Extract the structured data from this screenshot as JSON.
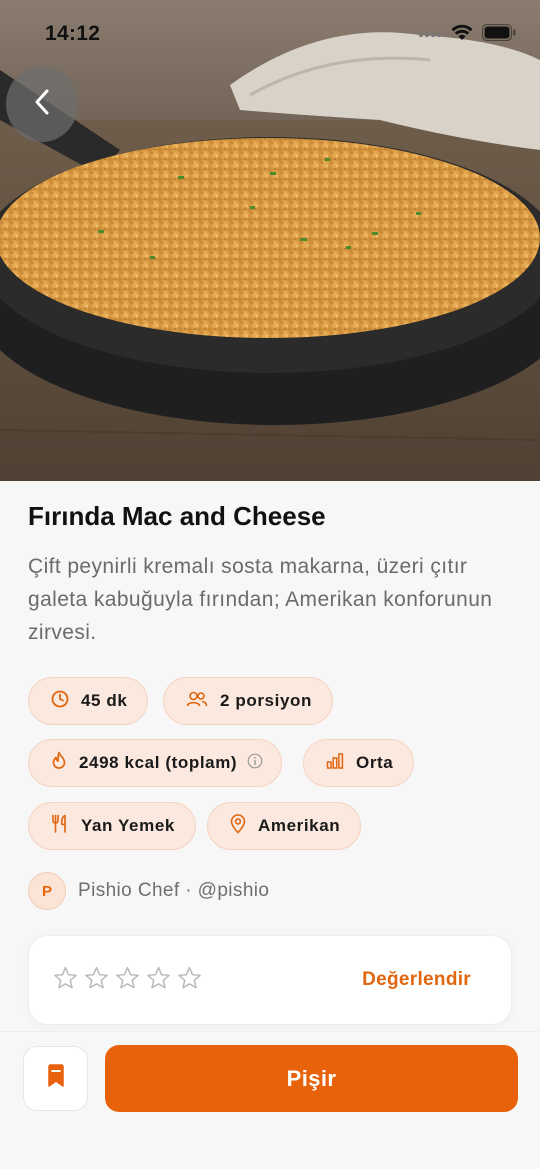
{
  "status_bar": {
    "time": "14:12"
  },
  "recipe": {
    "title": "Fırında Mac and Cheese",
    "description": "Çift peynirli kremalı sosta makarna, üzeri çıtır galeta kabuğuyla fırından; Amerikan konforunun zirvesi."
  },
  "chips": {
    "time": {
      "label": "45 dk",
      "icon": "clock-icon"
    },
    "servings": {
      "label": "2 porsiyon",
      "icon": "users-icon"
    },
    "calories": {
      "label": "2498 kcal (toplam)",
      "icon": "flame-icon",
      "info_icon": "info-icon"
    },
    "difficulty": {
      "label": "Orta",
      "icon": "bar-chart-icon"
    },
    "category": {
      "label": "Yan Yemek",
      "icon": "fork-knife-icon"
    },
    "cuisine": {
      "label": "Amerikan",
      "icon": "map-pin-icon"
    }
  },
  "author": {
    "initial": "P",
    "text": "Pishio Chef · @pishio"
  },
  "rating": {
    "stars_filled": 0,
    "stars_total": 5,
    "rate_label": "Değerlendir"
  },
  "actions": {
    "cook_label": "Pişir",
    "bookmark_icon": "bookmark-icon"
  },
  "colors": {
    "accent": "#e8620c",
    "chip_bg": "#fbe8de",
    "chip_border": "#f5d3c1"
  }
}
